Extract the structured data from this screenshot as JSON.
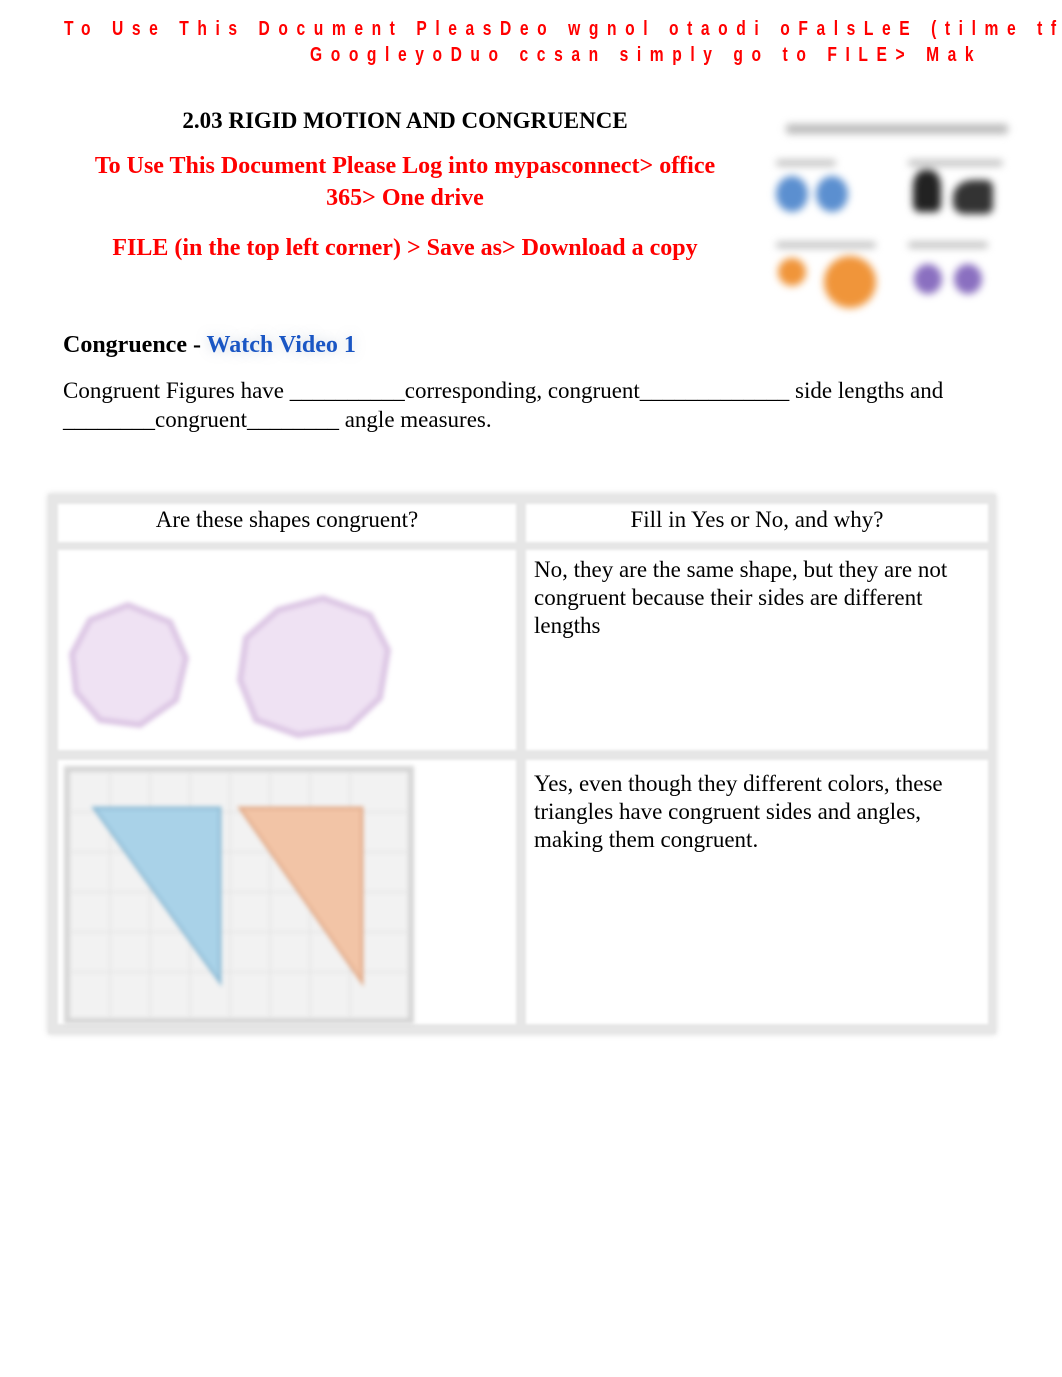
{
  "banner": {
    "line1": "To Use This Document PleasDeo wgnol otaodi oFalsLeE (tilme tfhiel et",
    "line2": "GoogleyoDuo ccsan simply go to FILE> Mak"
  },
  "header": {
    "title": "2.03 RIGID MOTION AND CONGRUENCE",
    "instruction_line1": "To Use This Document Please Log into mypasconnect> office",
    "instruction_line2": "365> One drive",
    "instruction_line3": "FILE (in the top left corner) > Save as> Download a copy"
  },
  "thumbnail": {
    "colors": [
      "#5b8fd0",
      "#222222",
      "#f0953a",
      "#8a6fc0"
    ]
  },
  "section": {
    "heading": "Congruence - ",
    "link": "Watch Video 1",
    "link_color": "#1a56c4"
  },
  "paragraph": {
    "line1": "Congruent Figures have __________corresponding, congruent_____________ side lengths and",
    "line2": "________congruent________ angle measures."
  },
  "table": {
    "headers": [
      "Are these shapes congruent?",
      "Fill in Yes or No, and why?"
    ],
    "rows": [
      {
        "figure": "Two pink/lavender octagon-like shapes of different sizes",
        "answer": "No, they are the same shape, but they are not congruent because their sides are different lengths"
      },
      {
        "figure": "Blue triangle and orange triangle on a grid",
        "answer": "Yes, even though they different colors, these triangles have congruent sides and angles, making them congruent."
      }
    ]
  },
  "colors": {
    "red_text": "#ff0000",
    "blue_triangle": "#a9d2e8",
    "orange_triangle": "#f2c4a6",
    "lavender_shape": "#efe2f3"
  }
}
